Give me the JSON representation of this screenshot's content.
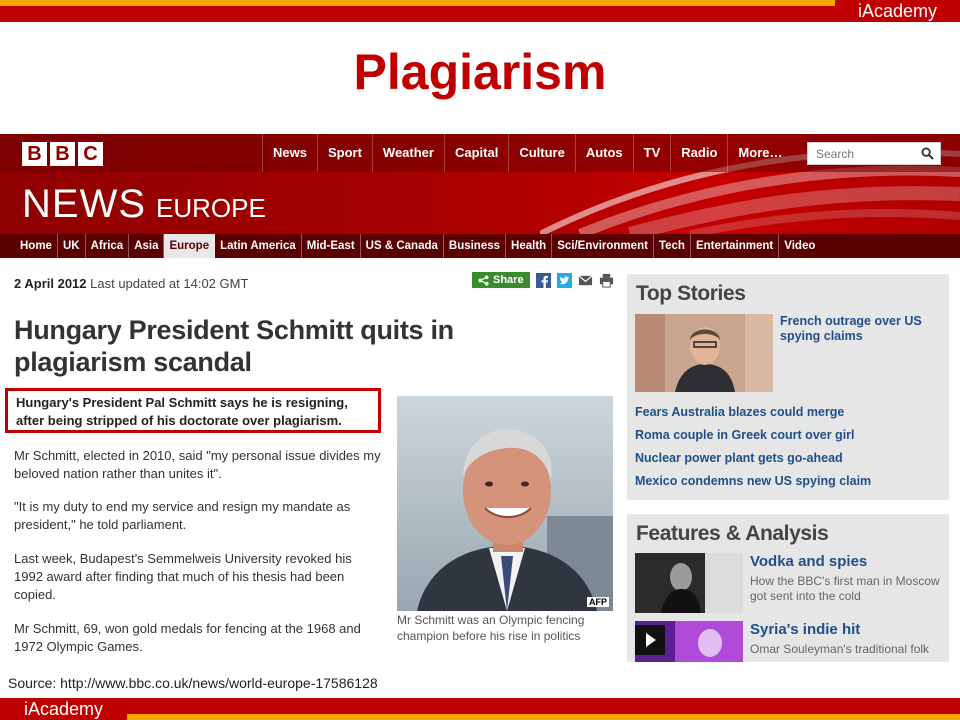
{
  "slide": {
    "brand_top": "iAcademy",
    "title": "Plagiarism",
    "source": "Source: http://www.bbc.co.uk/news/world-europe-17586128",
    "brand_bottom": "iAcademy",
    "colors": {
      "accent_red": "#c00000",
      "accent_gold": "#f2a900"
    }
  },
  "bbc": {
    "logo_letters": [
      "B",
      "B",
      "C"
    ],
    "topnav": [
      "News",
      "Sport",
      "Weather",
      "Capital",
      "Culture",
      "Autos",
      "TV",
      "Radio",
      "More…"
    ],
    "search_placeholder": "Search",
    "brand_news": "NEWS",
    "brand_edition": "EUROPE",
    "subnav": [
      "Home",
      "UK",
      "Africa",
      "Asia",
      "Europe",
      "Latin America",
      "Mid-East",
      "US & Canada",
      "Business",
      "Health",
      "Sci/Environment",
      "Tech",
      "Entertainment",
      "Video"
    ],
    "subnav_active": "Europe",
    "colors": {
      "header_red": "#a80000",
      "subnav": "#5a0000",
      "link_blue": "#1f4f8a"
    }
  },
  "article": {
    "date": "2 April 2012",
    "updated": "Last updated at 14:02 GMT",
    "share_label": "Share",
    "headline": "Hungary President Schmitt quits in plagiarism scandal",
    "lede": "Hungary's President Pal Schmitt says he is resigning, after being stripped of his doctorate over plagiarism.",
    "paragraphs": [
      "Mr Schmitt, elected in 2010, said \"my personal issue divides my beloved nation rather than unites it\".",
      "\"It is my duty to end my service and resign my mandate as president,\" he told parliament.",
      "Last week, Budapest's Semmelweis University revoked his 1992 award after finding that much of his thesis had been copied.",
      "Mr Schmitt, 69, won gold medals for fencing at the 1968 and 1972 Olympic Games."
    ],
    "photo_credit": "AFP",
    "caption": "Mr Schmitt was an Olympic fencing champion before his rise in politics"
  },
  "sidebar": {
    "top_stories": {
      "title": "Top Stories",
      "lead": "French outrage over US spying claims",
      "links": [
        "Fears Australia blazes could merge",
        "Roma couple in Greek court over girl",
        "Nuclear power plant gets go-ahead",
        "Mexico condemns new US spying claim"
      ]
    },
    "features": {
      "title": "Features & Analysis",
      "items": [
        {
          "title": "Vodka and spies",
          "summary": "How the BBC's first man in Moscow got sent into the cold"
        },
        {
          "title": "Syria's indie hit",
          "summary": "Omar Souleyman's traditional folk"
        }
      ]
    }
  }
}
